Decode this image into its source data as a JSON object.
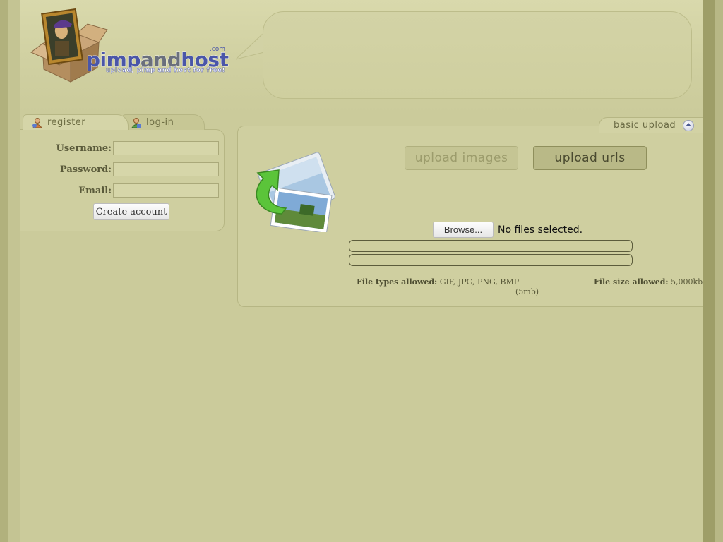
{
  "brand": {
    "name_part1": "pimp",
    "name_part2": "and",
    "name_part3": "host",
    "domain_suffix": ".com",
    "tagline": "upload, pimp and host for free!"
  },
  "auth": {
    "tabs": [
      {
        "label": "register",
        "icon": "user-add-icon",
        "active": true
      },
      {
        "label": "log-in",
        "icon": "user-login-icon",
        "active": false
      }
    ],
    "fields": [
      {
        "label": "Username:",
        "value": ""
      },
      {
        "label": "Password:",
        "value": ""
      },
      {
        "label": "Email:",
        "value": ""
      }
    ],
    "submit_label": "Create account"
  },
  "upload": {
    "panel_title": "basic upload",
    "collapse_icon": "collapse-up-icon",
    "mode_images": "upload images",
    "mode_urls": "upload urls",
    "active_mode": "upload urls",
    "browse_label": "Browse...",
    "file_status": "No files selected.",
    "progress": [
      0,
      0
    ],
    "types_label": "File types allowed:",
    "types_value": "GIF, JPG, PNG, BMP",
    "types_extra": "(5mb)",
    "size_label": "File size allowed:",
    "size_value": "5,000kb"
  },
  "colors": {
    "background": "#cbcb9b",
    "panel": "#cfcfa0",
    "border": "#b6b684",
    "brand_blue": "#4a56a8"
  }
}
